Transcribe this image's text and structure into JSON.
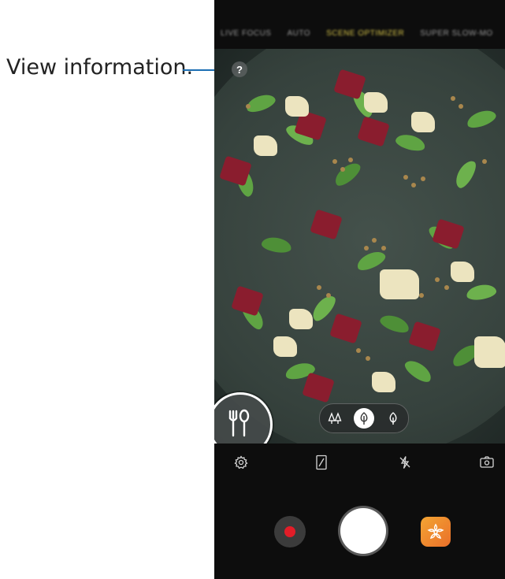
{
  "callout": {
    "text": "View information."
  },
  "modes": [
    {
      "label": "LIVE FOCUS",
      "active": false
    },
    {
      "label": "AUTO",
      "active": false
    },
    {
      "label": "SCENE OPTIMIZER",
      "active": true
    },
    {
      "label": "SUPER SLOW-MO",
      "active": false
    }
  ],
  "viewfinder": {
    "info_button": {
      "label": "?"
    },
    "scene": {
      "icon": "fork-spoon-icon"
    },
    "filters": [
      {
        "icon": "tree-cluster-icon",
        "active": false
      },
      {
        "icon": "tree-icon",
        "active": true
      },
      {
        "icon": "leaf-icon",
        "active": false
      }
    ]
  },
  "toolbar": [
    {
      "icon": "gear-icon"
    },
    {
      "icon": "aspect-ratio-icon"
    },
    {
      "icon": "flash-off-icon"
    },
    {
      "icon": "switch-camera-icon"
    }
  ],
  "controls": {
    "record": {
      "icon": "record-icon"
    },
    "shutter": {
      "icon": "shutter-button"
    },
    "gallery": {
      "icon": "flower-gallery-icon"
    }
  },
  "colors": {
    "record_red": "#e21d28",
    "gallery_orange": "#f08a2e",
    "callout_line": "#1c6fb4"
  }
}
